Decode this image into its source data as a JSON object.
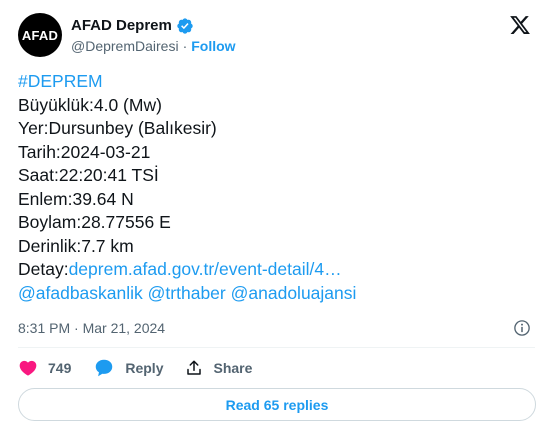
{
  "account": {
    "avatar_text": "AFAD",
    "display_name": "AFAD Deprem",
    "handle": "@DepremDairesi",
    "separator": "·",
    "follow_label": "Follow",
    "verified_color": "#1d9bf0"
  },
  "tweet": {
    "hashtag": "#DEPREM",
    "lines": [
      "Büyüklük:4.0 (Mw)",
      "Yer:Dursunbey (Balıkesir)",
      "Tarih:2024-03-21",
      "Saat:22:20:41 TSİ",
      "Enlem:39.64 N",
      "Boylam:28.77556 E",
      "Derinlik:7.7 km"
    ],
    "detail_label": "Detay:",
    "detail_link": "deprem.afad.gov.tr/event-detail/4…",
    "mentions": [
      "@afadbaskanlik",
      "@trthaber",
      "@anadoluajansi"
    ],
    "timestamp": "8:31 PM · Mar 21, 2024"
  },
  "actions": {
    "like_count": "749",
    "reply_label": "Reply",
    "share_label": "Share",
    "like_color": "#f91880"
  },
  "replies_button": "Read 65 replies",
  "colors": {
    "link": "#1d9bf0",
    "secondary_text": "#536471",
    "text": "#0f1419"
  }
}
